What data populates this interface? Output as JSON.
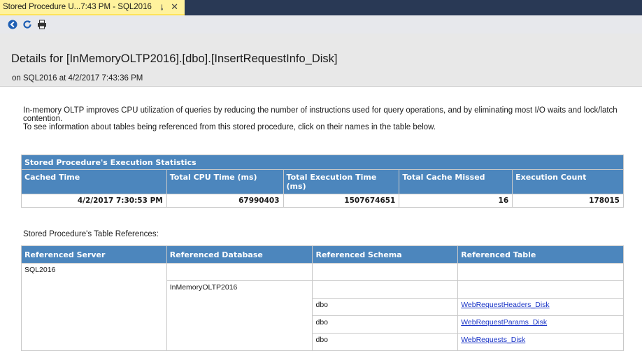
{
  "tab": {
    "title": "Stored Procedure U...7:43 PM - SQL2016",
    "pin_glyph": "⊸",
    "close_glyph": "✕"
  },
  "toolbar": {
    "icons": [
      "back-icon",
      "refresh-icon",
      "print-icon"
    ]
  },
  "header": {
    "title": "Details for [InMemoryOLTP2016].[dbo].[InsertRequestInfo_Disk]",
    "subtitle": "on SQL2016 at 4/2/2017 7:43:36 PM"
  },
  "intro": {
    "line1": "In-memory OLTP improves CPU utilization of queries by reducing the number of instructions used for query operations, and by eliminating most I/O waits and lock/latch contention.",
    "line2": "To see information about tables being referenced from this stored procedure, click on their names in the table below."
  },
  "stats_table": {
    "caption": "Stored Procedure's Execution Statistics",
    "headers": [
      "Cached Time",
      "Total CPU Time (ms)",
      "Total Execution Time (ms)",
      "Total Cache Missed",
      "Execution Count"
    ],
    "values": [
      "4/2/2017 7:30:53 PM",
      "67990403",
      "1507674651",
      "16",
      "178015"
    ]
  },
  "refs_section_label": "Stored Procedure's Table References:",
  "refs_table": {
    "headers": [
      "Referenced Server",
      "Referenced Database",
      "Referenced Schema",
      "Referenced Table"
    ],
    "server": "SQL2016",
    "database": "InMemoryOLTP2016",
    "rows": [
      {
        "schema": "dbo",
        "table": "WebRequestHeaders_Disk"
      },
      {
        "schema": "dbo",
        "table": "WebRequestParams_Disk"
      },
      {
        "schema": "dbo",
        "table": "WebRequests_Disk"
      }
    ]
  },
  "colors": {
    "tab_strip": "#293955",
    "active_tab": "#fff29d",
    "table_header": "#4c86bd",
    "link": "#1a35c7"
  }
}
